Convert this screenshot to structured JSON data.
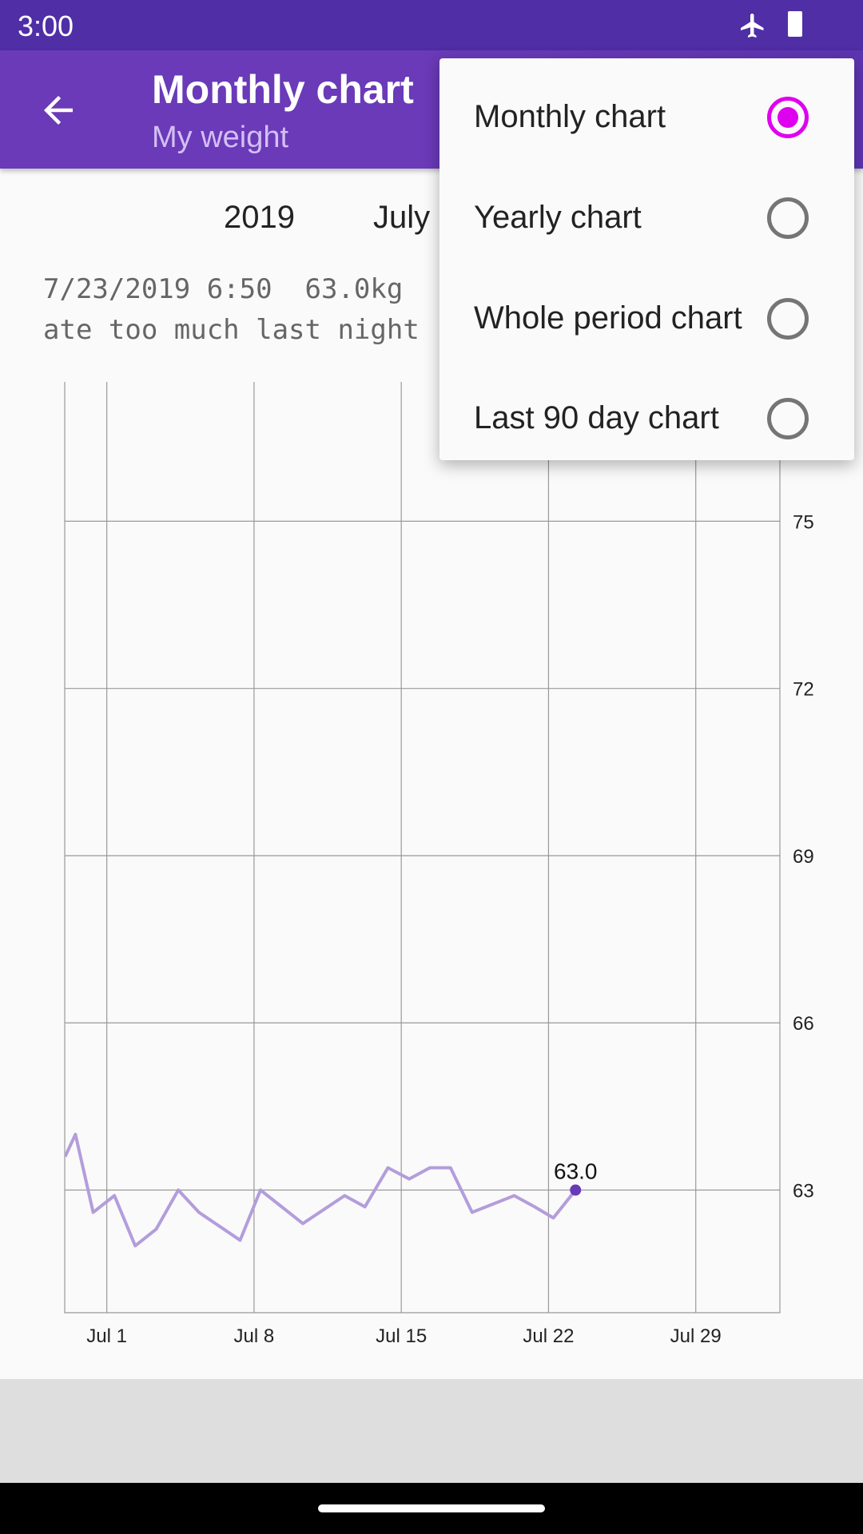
{
  "status_bar": {
    "time": "3:00",
    "icons": [
      "airplane-icon",
      "battery-icon"
    ]
  },
  "toolbar": {
    "title": "Monthly chart",
    "subtitle": "My weight",
    "back_icon": "arrow-left-icon"
  },
  "period": {
    "year": "2019",
    "month": "July"
  },
  "note": {
    "line1": "7/23/2019 6:50  63.0kg",
    "line2": "ate too much last night"
  },
  "menu": {
    "items": [
      {
        "label": "Monthly chart",
        "selected": true
      },
      {
        "label": "Yearly chart",
        "selected": false
      },
      {
        "label": "Whole period chart",
        "selected": false
      },
      {
        "label": "Last 90 day chart",
        "selected": false
      }
    ]
  },
  "colors": {
    "primary": "#6a3ab8",
    "status": "#4f2ea6",
    "line": "#b39ddb",
    "point": "#673ab7",
    "radio_selected": "#e000f0"
  },
  "chart_data": {
    "type": "line",
    "x_range": [
      "2019-06-29T00:00",
      "2019-08-02T00:00"
    ],
    "ylim": [
      60.8,
      77.5
    ],
    "y_axis_position": "right",
    "yticks": [
      63,
      66,
      69,
      72,
      75
    ],
    "xticks": [
      {
        "date": "2019-07-01",
        "label": "Jul 1"
      },
      {
        "date": "2019-07-08",
        "label": "Jul 8"
      },
      {
        "date": "2019-07-15",
        "label": "Jul 15"
      },
      {
        "date": "2019-07-22",
        "label": "Jul 22"
      },
      {
        "date": "2019-07-29",
        "label": "Jul 29"
      }
    ],
    "grid": true,
    "highlight": {
      "x": "2019-07-23T06:50",
      "y": 63.0,
      "label": "63.0"
    },
    "points": [
      {
        "x": "2019-06-29T00:30",
        "y": 63.6
      },
      {
        "x": "2019-06-29T12:15",
        "y": 64.0
      },
      {
        "x": "2019-06-30T08:25",
        "y": 62.6
      },
      {
        "x": "2019-07-01T08:40",
        "y": 62.9
      },
      {
        "x": "2019-07-02T08:25",
        "y": 62.0
      },
      {
        "x": "2019-07-03T08:25",
        "y": 62.3
      },
      {
        "x": "2019-07-04T09:35",
        "y": 63.0
      },
      {
        "x": "2019-07-05T09:05",
        "y": 62.6
      },
      {
        "x": "2019-07-07T08:10",
        "y": 62.1
      },
      {
        "x": "2019-07-08T07:25",
        "y": 63.0
      },
      {
        "x": "2019-07-10T07:40",
        "y": 62.4
      },
      {
        "x": "2019-07-12T07:25",
        "y": 62.9
      },
      {
        "x": "2019-07-13T06:30",
        "y": 62.7
      },
      {
        "x": "2019-07-14T08:50",
        "y": 63.4
      },
      {
        "x": "2019-07-15T09:05",
        "y": 63.2
      },
      {
        "x": "2019-07-16T08:40",
        "y": 63.4
      },
      {
        "x": "2019-07-17T08:10",
        "y": 63.4
      },
      {
        "x": "2019-07-18T08:50",
        "y": 62.6
      },
      {
        "x": "2019-07-20T08:50",
        "y": 62.9
      },
      {
        "x": "2019-07-21T08:10",
        "y": 62.7
      },
      {
        "x": "2019-07-22T05:30",
        "y": 62.5
      },
      {
        "x": "2019-07-23T06:50",
        "y": 63.0
      }
    ]
  }
}
